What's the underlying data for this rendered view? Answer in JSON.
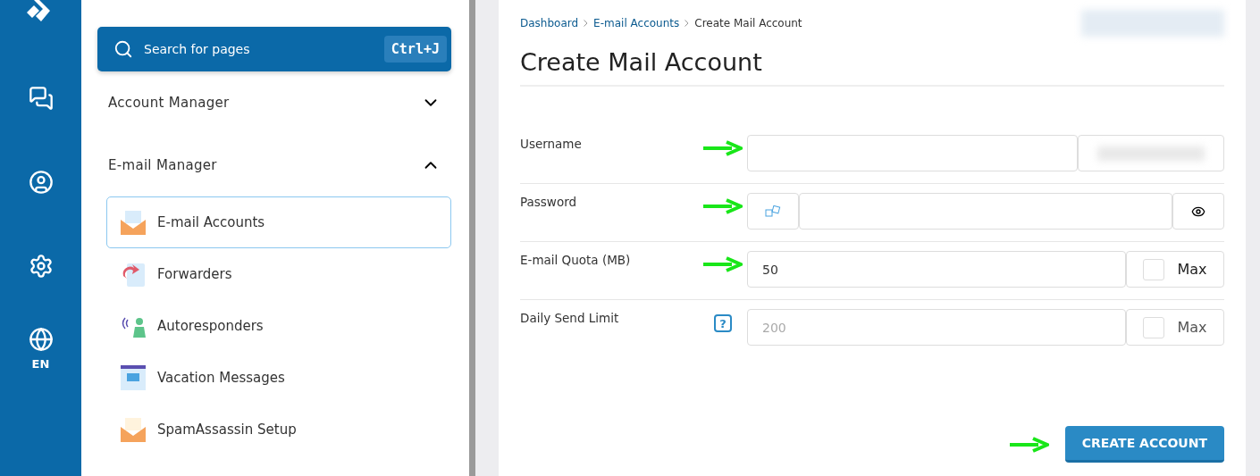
{
  "rail": {
    "language": "EN"
  },
  "sidebar": {
    "search": {
      "placeholder": "Search for pages",
      "shortcut": "Ctrl+J"
    },
    "sections": [
      {
        "title": "Account Manager",
        "expanded": false
      },
      {
        "title": "E-mail Manager",
        "expanded": true,
        "items": [
          {
            "label": "E-mail Accounts",
            "selected": true,
            "kind": "accounts"
          },
          {
            "label": "Forwarders",
            "selected": false,
            "kind": "forwarders"
          },
          {
            "label": "Autoresponders",
            "selected": false,
            "kind": "autoresponders"
          },
          {
            "label": "Vacation Messages",
            "selected": false,
            "kind": "vacation"
          },
          {
            "label": "SpamAssassin Setup",
            "selected": false,
            "kind": "spam"
          }
        ]
      }
    ]
  },
  "breadcrumb": [
    "Dashboard",
    "E-mail Accounts",
    "Create Mail Account"
  ],
  "title": "Create Mail Account",
  "fields": [
    {
      "kind": "username",
      "label": "Username"
    },
    {
      "kind": "password",
      "label": "Password"
    },
    {
      "kind": "quota",
      "label": "E-mail Quota (MB)",
      "value": "50",
      "max_label": "Max",
      "checked": false
    },
    {
      "kind": "limit",
      "label": "Daily Send Limit",
      "placeholder": "200",
      "max_label": "Max",
      "checked": false,
      "help": "?"
    }
  ],
  "submit": "CREATE ACCOUNT"
}
